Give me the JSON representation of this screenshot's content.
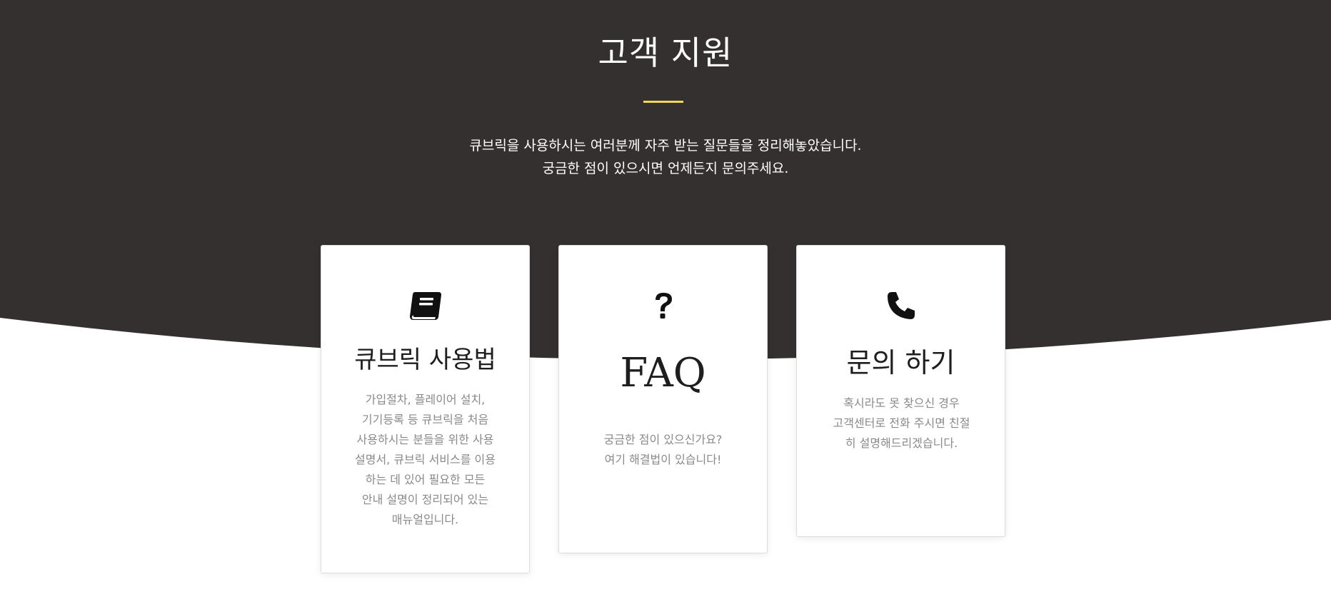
{
  "hero": {
    "title": "고객 지원",
    "description_lines": [
      "큐브릭을 사용하시는 여러분께 자주 받는 질문들을 정리해놓았습니다.",
      "궁금한 점이 있으시면 언제든지 문의주세요."
    ]
  },
  "cards": [
    {
      "icon": "book-icon",
      "title": "큐브릭 사용법",
      "description_lines": [
        "가입절차, 플레이어 설치,",
        "기기등록 등 큐브릭을 처음",
        "사용하시는 분들을 위한 사용",
        "설명서, 큐브릭 서비스를 이용",
        "하는 데 있어 필요한 모든",
        "안내 설명이 정리되어 있는",
        "매뉴얼입니다."
      ]
    },
    {
      "icon": "question-mark-icon",
      "title": "FAQ",
      "description_lines": [
        "궁금한 점이 있으신가요?",
        "여기 해결법이 있습니다!"
      ]
    },
    {
      "icon": "phone-icon",
      "title": "문의 하기",
      "description_lines": [
        "혹시라도 못 찾으신 경우",
        "고객센터로 전화 주시면 친절",
        "히 설명해드리겠습니다."
      ]
    }
  ],
  "colors": {
    "hero_background": "#353030",
    "accent": "#f0d84f",
    "card_text": "#8a8a8a",
    "title_text": "#1e1e1e"
  }
}
